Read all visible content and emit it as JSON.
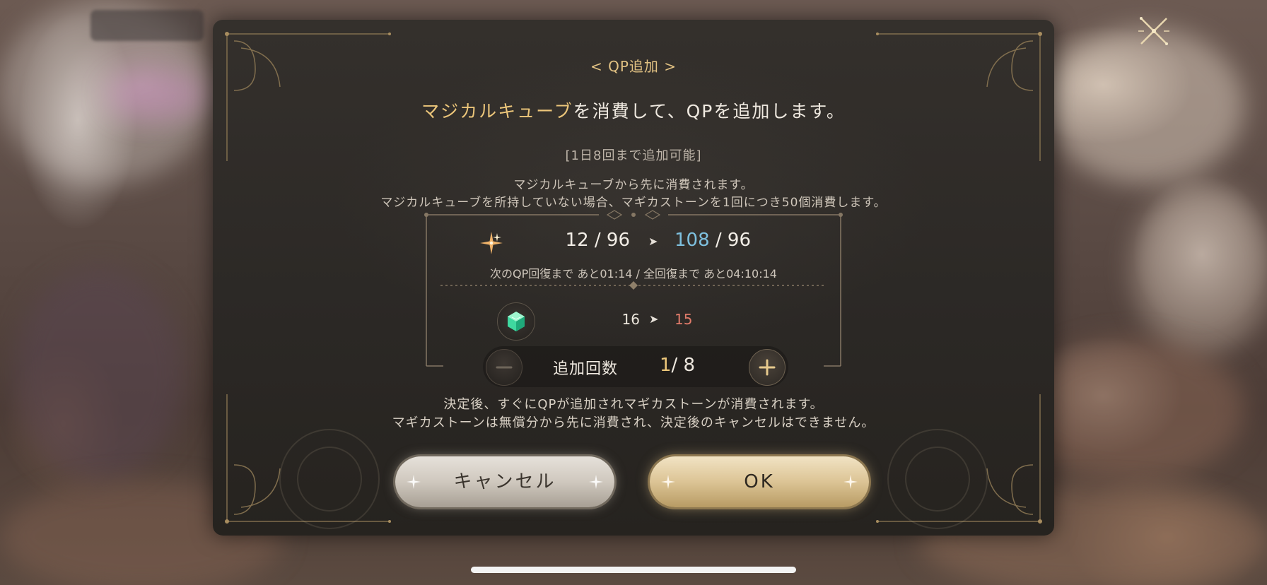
{
  "dialog": {
    "title": "< QP追加 >",
    "headline_highlight": "マジカルキューブ",
    "headline_rest": "を消費して、QPを追加します。",
    "limit_note": "[1日8回まで追加可能]",
    "desc_line1": "マジカルキューブから先に消費されます。",
    "desc_line2": "マジカルキューブを所持していない場合、マギカストーンを1回につき50個消費します。"
  },
  "qp": {
    "current": "12 / 96",
    "arrow": "➤",
    "next_value": "108",
    "next_max": " / 96",
    "recovery_text": "次のQP回復まで あと01:14  / 全回復まで あと04:10:14"
  },
  "cube": {
    "current": "16",
    "arrow": "➤",
    "next": "15"
  },
  "stepper": {
    "label": "追加回数",
    "current": "1",
    "max": "/ 8"
  },
  "notes": {
    "line1": "決定後、すぐにQPが追加されマギカストーンが消費されます。",
    "line2": "マギカストーンは無償分から先に消費され、決定後のキャンセルはできません。"
  },
  "buttons": {
    "cancel_label": "キャンセル",
    "ok_label": "OK"
  },
  "colors": {
    "accent_gold": "#ecc67a",
    "qp_blue": "#7ec0de",
    "decrease_red": "#e07b6a",
    "dialog_bg": "#2b2825"
  },
  "icons": {
    "close": "close-x-icon",
    "qp": "sparkle-icon",
    "cube": "magical-cube-icon",
    "minus": "minus-icon",
    "plus": "plus-icon"
  }
}
